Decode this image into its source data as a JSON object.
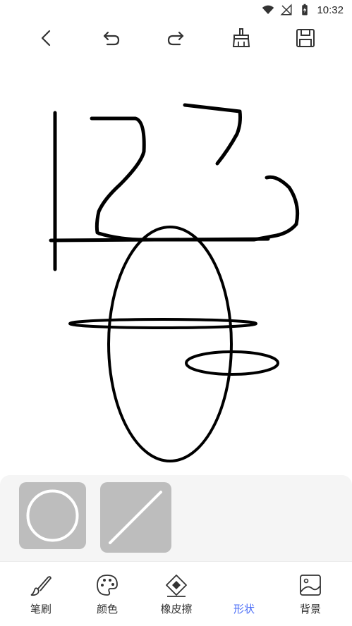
{
  "status_bar": {
    "time": "10:32"
  },
  "bottom_nav": {
    "items": [
      {
        "label": "笔刷"
      },
      {
        "label": "颜色"
      },
      {
        "label": "橡皮擦"
      },
      {
        "label": "形状"
      },
      {
        "label": "背景"
      }
    ],
    "active_index": 3,
    "active_color": "#4a6cf7"
  },
  "shape_panel": {
    "options": [
      {
        "shape": "circle"
      },
      {
        "shape": "line"
      }
    ]
  },
  "colors": {
    "ink": "#000000",
    "tile": "#bdbdbd",
    "panel": "#f5f5f5"
  }
}
